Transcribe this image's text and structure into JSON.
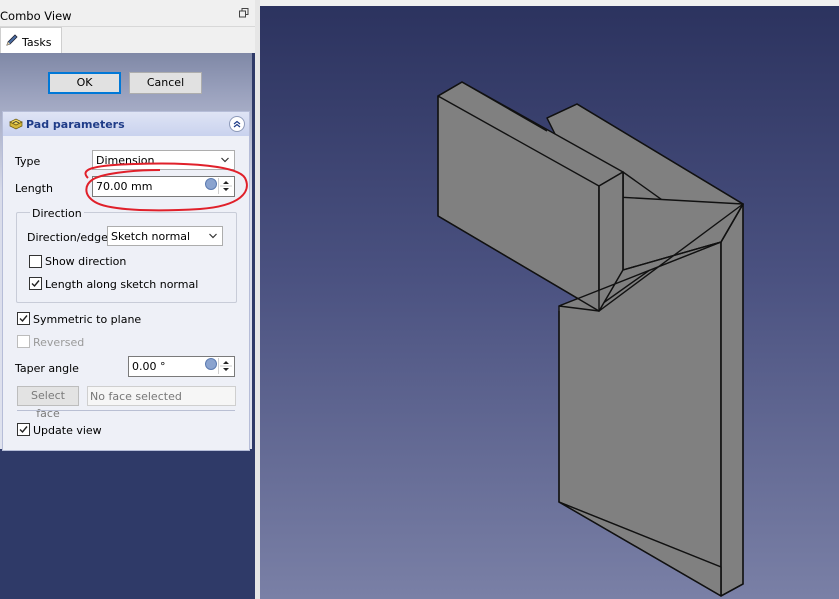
{
  "combo_view": {
    "title": "Combo View",
    "float_icon": "float-window-icon"
  },
  "tabs": [
    {
      "label": "Tasks",
      "icon": "pencil-icon"
    }
  ],
  "dialog_buttons": {
    "ok": "OK",
    "cancel": "Cancel"
  },
  "pad_parameters": {
    "title": "Pad parameters",
    "icon": "pad-icon",
    "type_label": "Type",
    "type_value": "Dimension",
    "length_label": "Length",
    "length_value": "70.00 mm",
    "direction": {
      "legend": "Direction",
      "edge_label": "Direction/edge:",
      "edge_value": "Sketch normal",
      "show_direction": {
        "label": "Show direction",
        "checked": false
      },
      "length_along_normal": {
        "label": "Length along sketch normal",
        "checked": true
      }
    },
    "symmetric": {
      "label": "Symmetric to plane",
      "checked": true
    },
    "reversed": {
      "label": "Reversed",
      "checked": false,
      "enabled": false
    },
    "taper_label": "Taper angle",
    "taper_value": "0.00 °",
    "select_face_label": "Select face",
    "face_field": "No face selected",
    "update_view": {
      "label": "Update view",
      "checked": true
    }
  },
  "annotation": {
    "color": "#e0202a"
  },
  "viewport": {
    "background_top": "#2c335f",
    "background_bottom": "#7a80a6",
    "model_fill": "#808080",
    "model_edge": "#111111"
  }
}
